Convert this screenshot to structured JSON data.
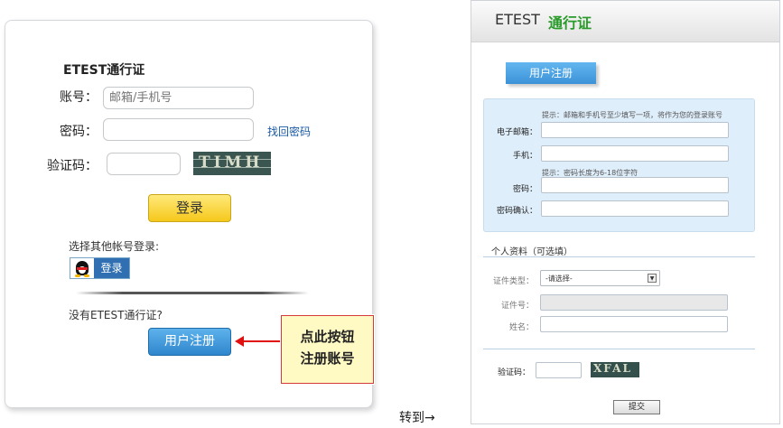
{
  "login": {
    "title": "ETEST通行证",
    "account_label": "账号：",
    "account_placeholder": "邮箱/手机号",
    "password_label": "密码：",
    "forgot_link": "找回密码",
    "captcha_label": "验证码：",
    "captcha_text": "TIMH",
    "login_button": "登录",
    "other_login_label": "选择其他帐号登录:",
    "qq_login_button": "登录",
    "no_account_text": "没有ETEST通行证?",
    "register_button": "用户注册",
    "callout_line1": "点此按钮",
    "callout_line2": "注册账号"
  },
  "transition": {
    "goto_text": "转到→"
  },
  "register": {
    "brand": "ETEST",
    "brand_cn": "通行证",
    "tab": "用户注册",
    "hint_email_phone": "提示：邮箱和手机号至少填写一项，将作为您的登录账号",
    "email_label": "电子邮箱：",
    "phone_label": "手机：",
    "hint_password": "提示：密码长度为6-18位字符",
    "password_label": "密码：",
    "password_confirm_label": "密码确认：",
    "personal_section": "个人资料（可选填）",
    "id_type_label": "证件类型：",
    "id_type_value": "-请选择-",
    "id_number_label": "证件号：",
    "name_label": "姓名：",
    "captcha_label": "验证码：",
    "captcha_text": "XFAL",
    "submit_button": "提交"
  },
  "colors": {
    "brand_green": "#2a9a2a",
    "primary_blue": "#3c92d8",
    "login_yellow": "#f5c81b",
    "callout_red": "#e01010"
  }
}
